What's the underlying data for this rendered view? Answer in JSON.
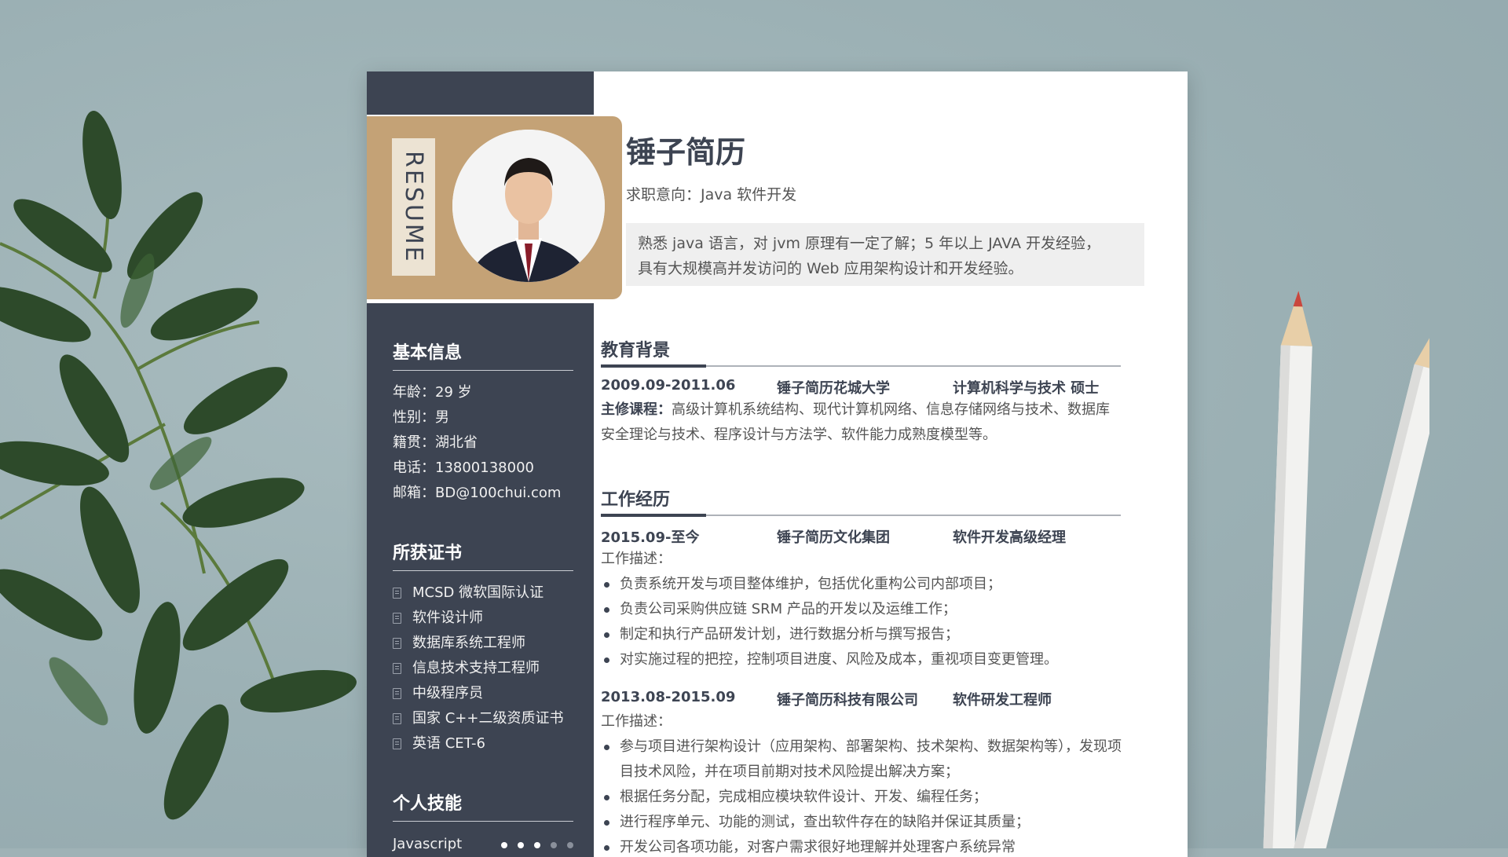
{
  "resume_tag": "RESUME",
  "name": "锤子简历",
  "intent": "求职意向：Java 软件开发",
  "summary": [
    "熟悉 java 语言，对 jvm 原理有一定了解；5 年以上 JAVA 开发经验，",
    "具有大规模高并发访问的 Web 应用架构设计和开发经验。"
  ],
  "basic_info": {
    "heading": "基本信息",
    "items": [
      "年龄：29 岁",
      "性别：男",
      "籍贯：湖北省",
      "电话：13800138000",
      "邮箱：BD@100chui.com"
    ]
  },
  "certs": {
    "heading": "所获证书",
    "items": [
      "MCSD 微软国际认证",
      "软件设计师",
      "数据库系统工程师",
      "信息技术支持工程师",
      "中级程序员",
      "国家 C++二级资质证书",
      "英语 CET-6"
    ]
  },
  "skills": {
    "heading": "个人技能",
    "items": [
      {
        "label": "Javascript",
        "level": 3,
        "max": 5
      }
    ]
  },
  "education": {
    "heading": "教育背景",
    "period": "2009.09-2011.06",
    "school": "锤子简历花城大学",
    "major": "计算机科学与技术  硕士",
    "courses_label": "主修课程：",
    "courses_line1": "高级计算机系统结构、现代计算机网络、信息存储网络与技术、数据库",
    "courses_line2": "安全理论与技术、程序设计与方法学、软件能力成熟度模型等。"
  },
  "work": {
    "heading": "工作经历",
    "jobs": [
      {
        "period": "2015.09-至今",
        "company": "锤子简历文化集团",
        "title": "软件开发高级经理",
        "desc_label": "工作描述：",
        "bullets": [
          "负责系统开发与项目整体维护，包括优化重构公司内部项目；",
          "负责公司采购供应链 SRM 产品的开发以及运维工作；",
          "制定和执行产品研发计划，进行数据分析与撰写报告；",
          "对实施过程的把控，控制项目进度、风险及成本，重视项目变更管理。"
        ]
      },
      {
        "period": "2013.08-2015.09",
        "company": "锤子简历科技有限公司",
        "title": "软件研发工程师",
        "desc_label": "工作描述：",
        "bullets": [
          "参与项目进行架构设计（应用架构、部署架构、技术架构、数据架构等），发现项目技术风险，并在项目前期对技术风险提出解决方案；",
          "根据任务分配，完成相应模块软件设计、开发、编程任务；",
          "进行程序单元、功能的测试，查出软件存在的缺陷并保证其质量；",
          "开发公司各项功能，对客户需求很好地理解并处理客户系统异常"
        ]
      }
    ]
  },
  "colors": {
    "sidebar": "#3d4452",
    "gold": "#c4a276",
    "background": "#9fb2b6"
  }
}
